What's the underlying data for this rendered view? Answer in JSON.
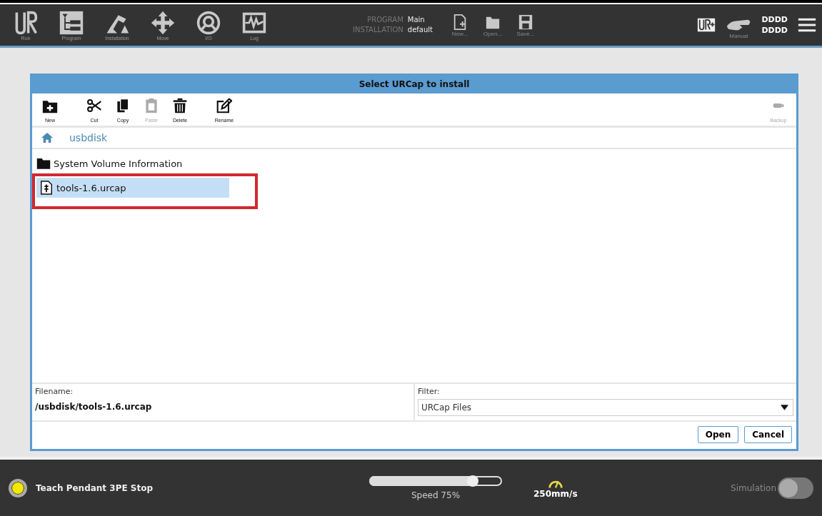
{
  "header": {
    "nav": [
      {
        "kind": "run",
        "label": "Run"
      },
      {
        "kind": "program",
        "label": "Program"
      },
      {
        "kind": "installation",
        "label": "Installation"
      },
      {
        "kind": "move",
        "label": "Move"
      },
      {
        "kind": "io",
        "label": "I/O"
      },
      {
        "kind": "log",
        "label": "Log"
      }
    ],
    "program_label": "PROGRAM",
    "program_value": "Main",
    "installation_label": "INSTALLATION",
    "installation_value": "default",
    "file_actions": [
      {
        "kind": "new",
        "label": "New..."
      },
      {
        "kind": "open",
        "label": "Open..."
      },
      {
        "kind": "save",
        "label": "Save..."
      }
    ],
    "mode": "Manual",
    "user_lines": [
      "DDDD",
      "DDDD"
    ]
  },
  "dialog": {
    "title": "Select URCap to install",
    "toolbar": [
      {
        "kind": "new",
        "label": "New",
        "disabled": false
      },
      {
        "kind": "cut",
        "label": "Cut",
        "disabled": false
      },
      {
        "kind": "copy",
        "label": "Copy",
        "disabled": false
      },
      {
        "kind": "paste",
        "label": "Paste",
        "disabled": true
      },
      {
        "kind": "delete",
        "label": "Delete",
        "disabled": false
      },
      {
        "kind": "rename",
        "label": "Rename",
        "disabled": false
      }
    ],
    "backup": {
      "label": "Backup",
      "disabled": true
    },
    "path": "usbdisk",
    "files": [
      {
        "kind": "folder",
        "name": "System Volume Information",
        "selected": false,
        "marked": false
      },
      {
        "kind": "file",
        "name": "tools-1.6.urcap",
        "selected": true,
        "marked": true
      }
    ],
    "filename_label": "Filename:",
    "filename": "/usbdisk/tools-1.6.urcap",
    "filter_label": "Filter:",
    "filter": "URCap Files",
    "buttons": [
      "Open",
      "Cancel"
    ]
  },
  "footer": {
    "status": "Teach Pendant 3PE Stop",
    "speed": {
      "level": 0.78,
      "reading": "Speed 75%"
    },
    "tcp_speed": "250mm/s",
    "simulation": {
      "label": "Simulation",
      "on": false
    }
  }
}
